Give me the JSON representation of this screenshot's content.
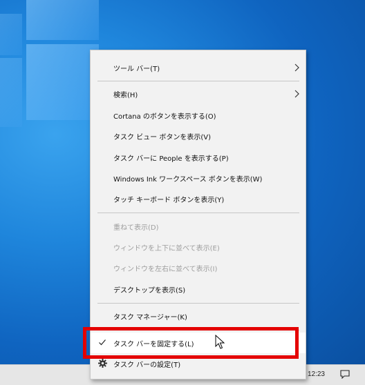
{
  "menu": {
    "items": [
      {
        "label": "ツール バー(T)",
        "state": "normal",
        "submenu": true
      },
      {
        "label": "検索(H)",
        "state": "normal",
        "submenu": true
      },
      {
        "label": "Cortana のボタンを表示する(O)",
        "state": "normal"
      },
      {
        "label": "タスク ビュー ボタンを表示(V)",
        "state": "normal"
      },
      {
        "label": "タスク バーに People を表示する(P)",
        "state": "normal"
      },
      {
        "label": "Windows Ink ワークスペース ボタンを表示(W)",
        "state": "normal"
      },
      {
        "label": "タッチ キーボード ボタンを表示(Y)",
        "state": "normal"
      },
      {
        "label": "重ねて表示(D)",
        "state": "disabled"
      },
      {
        "label": "ウィンドウを上下に並べて表示(E)",
        "state": "disabled"
      },
      {
        "label": "ウィンドウを左右に並べて表示(I)",
        "state": "disabled"
      },
      {
        "label": "デスクトップを表示(S)",
        "state": "normal"
      },
      {
        "label": "タスク マネージャー(K)",
        "state": "normal"
      },
      {
        "label": "タスク バーを固定する(L)",
        "state": "hover",
        "checked": true
      },
      {
        "label": "タスク バーの設定(T)",
        "state": "normal",
        "icon": "gear-icon"
      }
    ]
  },
  "taskbar": {
    "clock": "12:23"
  },
  "colors": {
    "highlight_box": "#e40000",
    "menu_background": "#f2f2f2",
    "hover_background": "#ffffff",
    "disabled_text": "#9d9d9d"
  }
}
